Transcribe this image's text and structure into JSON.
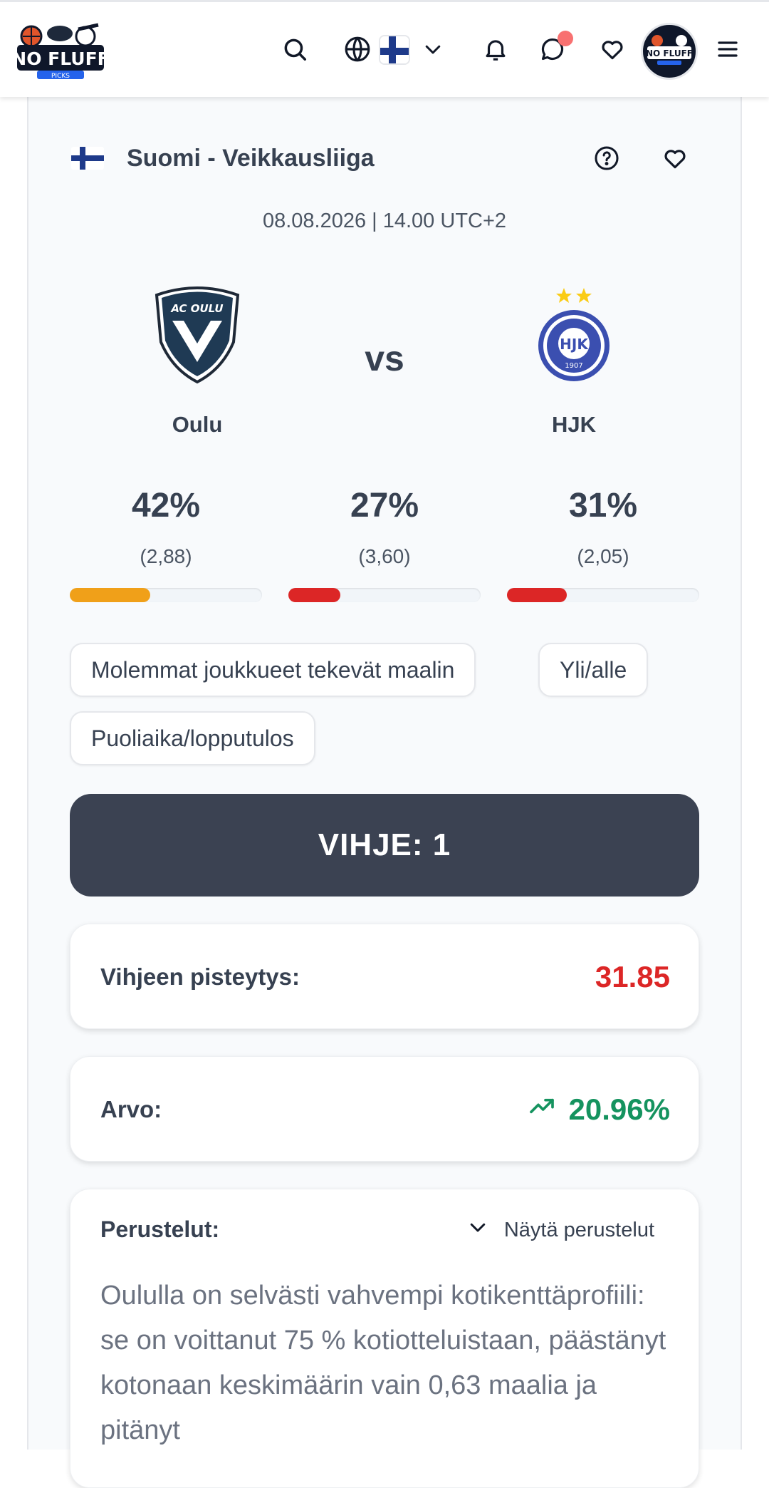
{
  "header": {
    "logo_text": "NO FLUFF",
    "logo_sub": "PICKS",
    "colors": {
      "accent_dot": "#f87171"
    }
  },
  "league": {
    "name": "Suomi - Veikkausliiga",
    "flag": "finland-flag"
  },
  "match": {
    "datetime": "08.08.2026 | 14.00 UTC+2",
    "vs_label": "vs",
    "home": {
      "name": "Oulu",
      "crest_text": "AC OULU"
    },
    "away": {
      "name": "HJK",
      "crest_text": "HJK",
      "crest_year": "1907"
    }
  },
  "probabilities": [
    {
      "pct": "42%",
      "odds": "(2,88)",
      "fill": 0.42,
      "color": "#f0a019"
    },
    {
      "pct": "27%",
      "odds": "(3,60)",
      "fill": 0.27,
      "color": "#dc2626"
    },
    {
      "pct": "31%",
      "odds": "(2,05)",
      "fill": 0.31,
      "color": "#dc2626"
    }
  ],
  "markets": [
    "Molemmat joukkueet tekevät maalin",
    "Yli/alle",
    "Puoliaika/lopputulos"
  ],
  "tip": {
    "label": "VIHJE: 1"
  },
  "score": {
    "label": "Vihjeen pisteytys:",
    "value": "31.85",
    "color": "#dc2626"
  },
  "value": {
    "label": "Arvo:",
    "value": "20.96%",
    "color": "#15935f"
  },
  "reasons": {
    "label": "Perustelut:",
    "toggle_label": "Näytä perustelut",
    "text": "Oululla on selvästi vahvempi kotikenttäprofiili: se on voittanut 75 % kotiotteluistaan, päästänyt kotonaan keskimäärin vain 0,63 maalia ja pitänyt"
  }
}
